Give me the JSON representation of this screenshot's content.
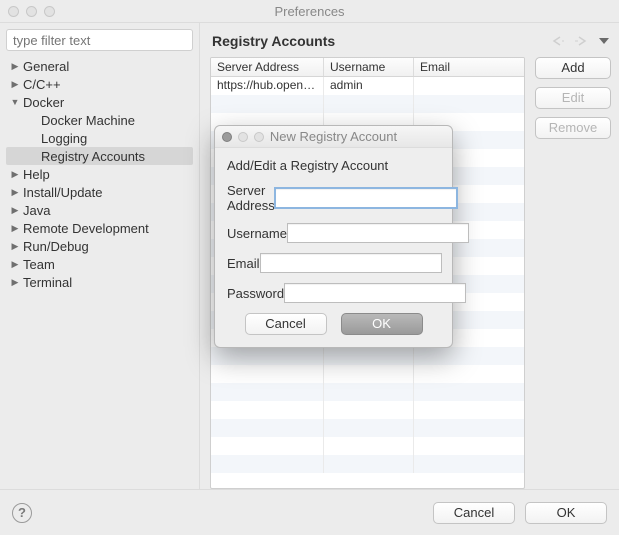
{
  "window": {
    "title": "Preferences"
  },
  "sidebar": {
    "filter_placeholder": "type filter text",
    "items": [
      {
        "label": "General",
        "level": 1,
        "expanded": false,
        "selected": false
      },
      {
        "label": "C/C++",
        "level": 1,
        "expanded": false,
        "selected": false
      },
      {
        "label": "Docker",
        "level": 1,
        "expanded": true,
        "selected": false
      },
      {
        "label": "Docker Machine",
        "level": 2,
        "expanded": null,
        "selected": false
      },
      {
        "label": "Logging",
        "level": 2,
        "expanded": null,
        "selected": false
      },
      {
        "label": "Registry Accounts",
        "level": 2,
        "expanded": null,
        "selected": true
      },
      {
        "label": "Help",
        "level": 1,
        "expanded": false,
        "selected": false
      },
      {
        "label": "Install/Update",
        "level": 1,
        "expanded": false,
        "selected": false
      },
      {
        "label": "Java",
        "level": 1,
        "expanded": false,
        "selected": false
      },
      {
        "label": "Remote Development",
        "level": 1,
        "expanded": false,
        "selected": false
      },
      {
        "label": "Run/Debug",
        "level": 1,
        "expanded": false,
        "selected": false
      },
      {
        "label": "Team",
        "level": 1,
        "expanded": false,
        "selected": false
      },
      {
        "label": "Terminal",
        "level": 1,
        "expanded": false,
        "selected": false
      }
    ]
  },
  "main": {
    "title": "Registry Accounts",
    "table": {
      "columns": [
        "Server Address",
        "Username",
        "Email"
      ],
      "rows": [
        {
          "server": "https://hub.open…",
          "username": "admin",
          "email": ""
        }
      ]
    },
    "buttons": {
      "add": {
        "label": "Add",
        "enabled": true
      },
      "edit": {
        "label": "Edit",
        "enabled": false
      },
      "remove": {
        "label": "Remove",
        "enabled": false
      }
    }
  },
  "dialog": {
    "title": "New Registry Account",
    "subtitle": "Add/Edit a Registry Account",
    "fields": {
      "server": {
        "label": "Server Address",
        "value": ""
      },
      "username": {
        "label": "Username",
        "value": ""
      },
      "email": {
        "label": "Email",
        "value": ""
      },
      "password": {
        "label": "Password",
        "value": ""
      }
    },
    "buttons": {
      "cancel": "Cancel",
      "ok": "OK"
    }
  },
  "footer": {
    "cancel": "Cancel",
    "ok": "OK"
  }
}
